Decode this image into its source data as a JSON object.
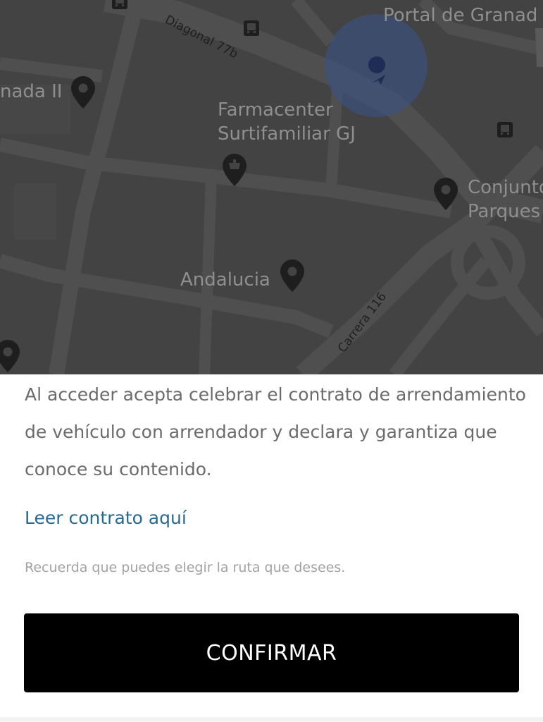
{
  "map": {
    "places": {
      "portal_de_granada": "Portal de Granad",
      "granada_ii": "nada II",
      "farmacenter_line1": "Farmacenter",
      "farmacenter_line2": "Surtifamiliar GJ",
      "conjunto_line1": "Conjunto",
      "conjunto_line2": "Parques",
      "andalucia": "Andalucia"
    },
    "streets": {
      "diagonal": "Diagonal 77b",
      "carrera": "Carrera 116"
    },
    "icons": {
      "place_pin": "map-pin-icon",
      "pharmacy_pin": "pharmacy-pin-icon",
      "bus_stop": "bus-stop-icon",
      "current_location": "current-location-icon"
    },
    "colors": {
      "background": "#434343",
      "roads": "#4d4d4d",
      "labels": "#8f8f8f",
      "location_halo": "#3a548c",
      "location_dot": "#1d2d55"
    }
  },
  "sheet": {
    "terms": "Al acceder acepta celebrar el contrato de arrendamiento de vehículo con arrendador y declara y garantiza que conoce su contenido.",
    "contract_link": "Leer contrato aquí",
    "route_hint": "Recuerda que puedes elegir la ruta que desees.",
    "confirm_label": "CONFIRMAR",
    "colors": {
      "link": "#276b94",
      "button_bg": "#000000",
      "button_text": "#ffffff"
    }
  }
}
